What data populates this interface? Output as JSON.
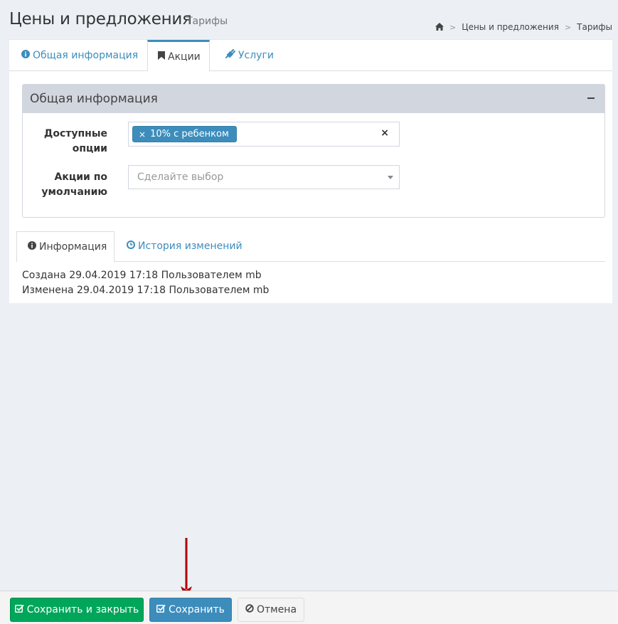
{
  "header": {
    "title": "Цены и предложения",
    "subtitle": "Тарифы",
    "breadcrumb": [
      "Цены и предложения",
      "Тарифы"
    ],
    "breadcrumb_separator": ">"
  },
  "tabs": [
    {
      "label": "Общая информация",
      "icon": "info-circle-icon",
      "active": false
    },
    {
      "label": "Акции",
      "icon": "bookmark-icon",
      "active": true
    },
    {
      "label": "Услуги",
      "icon": "plug-icon",
      "active": false
    }
  ],
  "box": {
    "title": "Общая информация",
    "fields": {
      "available_options": {
        "label_line1": "Доступные",
        "label_line2": "опции",
        "tag": "10% с ребенком",
        "tag_remove": "×",
        "clear": "×"
      },
      "default_promotions": {
        "label_line1": "Акции по",
        "label_line2": "умолчанию",
        "placeholder": "Сделайте выбор"
      }
    }
  },
  "info_tabs": [
    {
      "label": "Информация",
      "icon": "info-circle-icon",
      "active": true
    },
    {
      "label": "История изменений",
      "icon": "clock-icon",
      "active": false
    }
  ],
  "info": {
    "created": "Создана 29.04.2019 17:18 Пользователем mb",
    "modified": "Изменена 29.04.2019 17:18 Пользователем mb"
  },
  "footer": {
    "save_close_label": "Сохранить и закрыть",
    "save_label": "Сохранить",
    "cancel_label": "Отмена"
  },
  "colors": {
    "primary": "#3c8dbc",
    "success": "#00a65a",
    "annotation_arrow": "#b00000",
    "background": "#ecf0f5"
  }
}
